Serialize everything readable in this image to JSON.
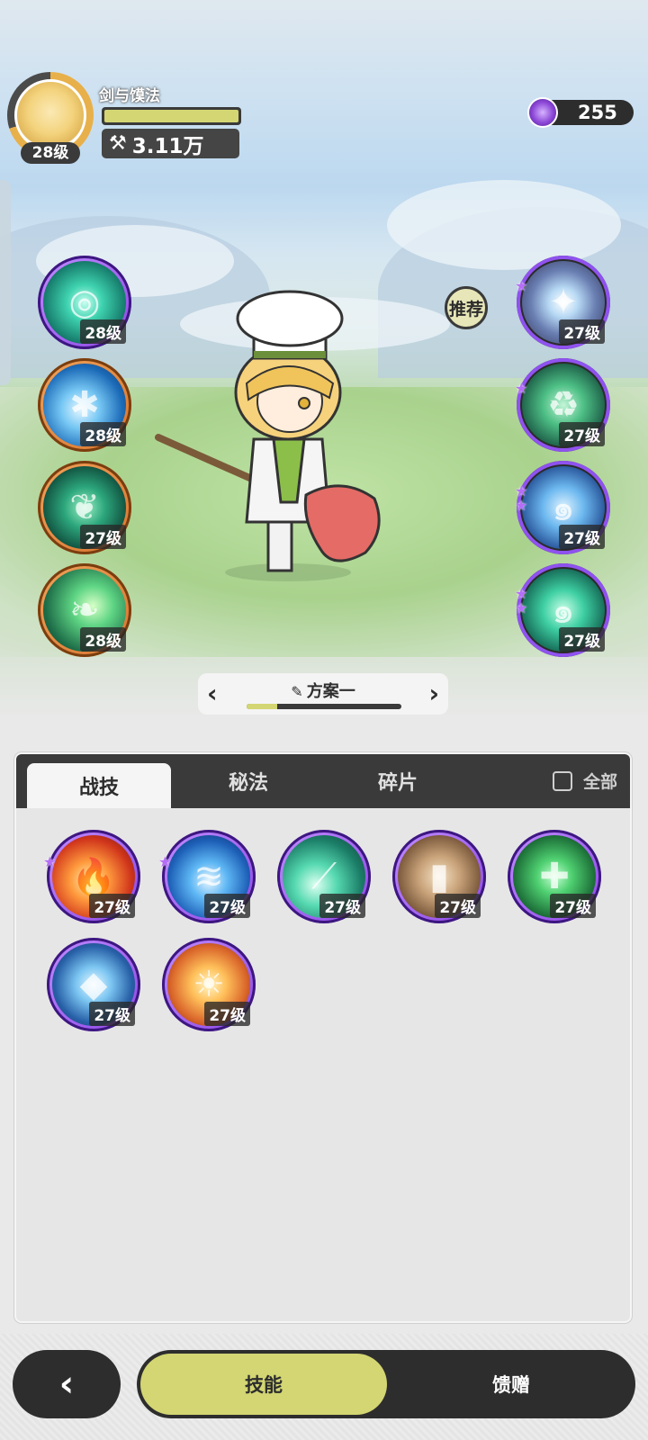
{
  "header": {
    "avatar_level": "28级",
    "player_name": "剑与馍法",
    "hp_fraction": 1.0,
    "power": "3.11万",
    "currency": "255"
  },
  "left_skills": [
    {
      "level": "28级",
      "icon": "vortex-icon"
    },
    {
      "level": "28级",
      "icon": "ice-burst-icon"
    },
    {
      "level": "27级",
      "icon": "thorn-icon"
    },
    {
      "level": "28级",
      "icon": "leaf-wind-icon"
    }
  ],
  "right_skills": [
    {
      "level": "27级",
      "icon": "star-sparkle-icon"
    },
    {
      "level": "27级",
      "icon": "recycle-icon"
    },
    {
      "level": "27级",
      "icon": "water-spirit-icon"
    },
    {
      "level": "27级",
      "icon": "poison-spirit-icon"
    }
  ],
  "recommend_label": "推荐",
  "loadout": {
    "name": "方案一",
    "progress": 0.2
  },
  "tabs": {
    "skills": "战技",
    "secret": "秘法",
    "shards": "碎片",
    "all": "全部"
  },
  "grid_skills": [
    {
      "level": "27级",
      "icon": "fire-icon"
    },
    {
      "level": "27级",
      "icon": "blue-fire-icon"
    },
    {
      "level": "27级",
      "icon": "wind-slash-icon"
    },
    {
      "level": "27级",
      "icon": "rock-card-icon"
    },
    {
      "level": "27级",
      "icon": "heal-cross-icon"
    },
    {
      "level": "27级",
      "icon": "ice-crystal-icon"
    },
    {
      "level": "27级",
      "icon": "sun-orb-icon"
    }
  ],
  "bottom": {
    "active": "技能",
    "inactive": "馈赠"
  },
  "colors": {
    "accent": "#d3d672",
    "dark": "#2d2d2d",
    "purple_ring": "#8f52ef",
    "orange_ring": "#e0843d"
  }
}
